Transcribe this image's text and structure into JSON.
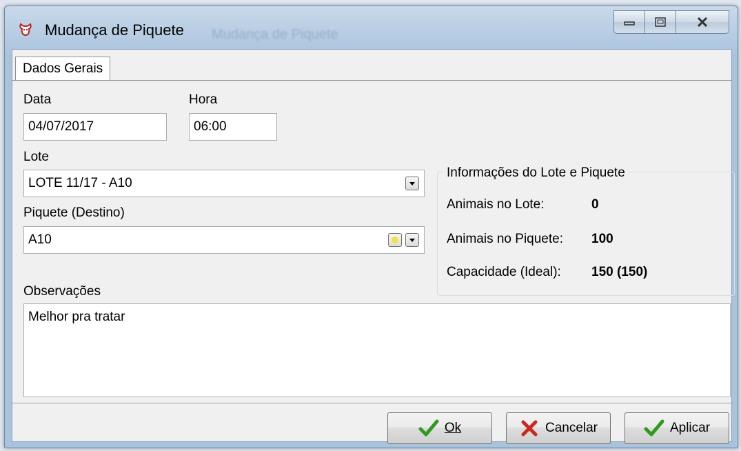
{
  "window": {
    "title": "Mudança de Piquete",
    "ghost_title": "Mudança de Piquete"
  },
  "tabs": [
    {
      "label": "Dados Gerais"
    }
  ],
  "form": {
    "data_label": "Data",
    "data_value": "04/07/2017",
    "hora_label": "Hora",
    "hora_value": "06:00",
    "lote_label": "Lote",
    "lote_value": "LOTE 11/17 - A10",
    "piquete_label": "Piquete (Destino)",
    "piquete_value": "A10",
    "observacoes_label": "Observações",
    "observacoes_value": "Melhor pra tratar"
  },
  "info": {
    "title": "Informações do Lote e Piquete",
    "animais_lote_label": "Animais no Lote:",
    "animais_lote_value": "0",
    "animais_piquete_label": "Animais no Piquete:",
    "animais_piquete_value": "100",
    "capacidade_label": "Capacidade  (Ideal):",
    "capacidade_value": "150 (150)"
  },
  "buttons": {
    "ok": "Ok",
    "cancelar": "Cancelar",
    "aplicar": "Aplicar"
  },
  "colors": {
    "check": "#2e9a1e",
    "cancel": "#c8281d",
    "star": "#f3e04a"
  },
  "icons": [
    "app-icon",
    "minimize-icon",
    "maximize-icon",
    "close-icon",
    "dropdown-arrow-icon",
    "star-icon",
    "check-icon",
    "x-icon"
  ]
}
